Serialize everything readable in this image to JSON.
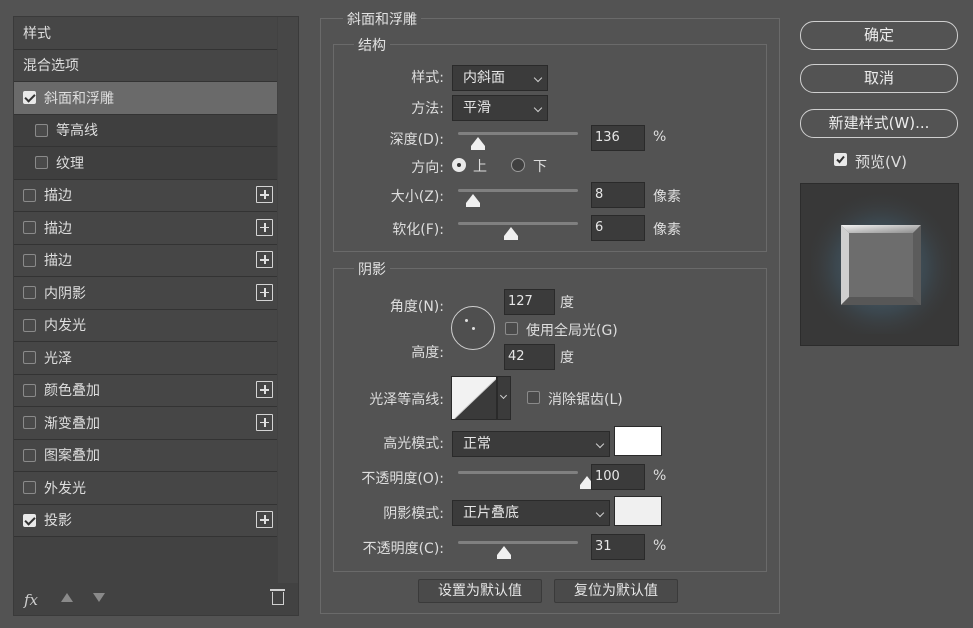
{
  "styles_panel": {
    "header": "样式",
    "blend_options": "混合选项",
    "items": [
      {
        "label": "斜面和浮雕",
        "checked": true,
        "selected": true,
        "plus": false
      },
      {
        "label": "等高线",
        "checked": false,
        "sub": true,
        "plus": false
      },
      {
        "label": "纹理",
        "checked": false,
        "sub": true,
        "plus": false
      },
      {
        "label": "描边",
        "checked": false,
        "plus": true
      },
      {
        "label": "描边",
        "checked": false,
        "plus": true
      },
      {
        "label": "描边",
        "checked": false,
        "plus": true
      },
      {
        "label": "内阴影",
        "checked": false,
        "plus": true
      },
      {
        "label": "内发光",
        "checked": false,
        "plus": false
      },
      {
        "label": "光泽",
        "checked": false,
        "plus": false
      },
      {
        "label": "颜色叠加",
        "checked": false,
        "plus": true
      },
      {
        "label": "渐变叠加",
        "checked": false,
        "plus": true
      },
      {
        "label": "图案叠加",
        "checked": false,
        "plus": false
      },
      {
        "label": "外发光",
        "checked": false,
        "plus": false
      },
      {
        "label": "投影",
        "checked": true,
        "plus": true
      }
    ],
    "footer_fx": "fx"
  },
  "bevel": {
    "title": "斜面和浮雕",
    "structure": {
      "title": "结构",
      "style_label": "样式:",
      "style_value": "内斜面",
      "technique_label": "方法:",
      "technique_value": "平滑",
      "depth_label": "深度(D):",
      "depth_value": "136",
      "depth_unit": "%",
      "depth_level": 0.09,
      "direction_label": "方向:",
      "direction_up": "上",
      "direction_down": "下",
      "size_label": "大小(Z):",
      "size_value": "8",
      "size_unit": "像素",
      "size_level": 0.05,
      "soften_label": "软化(F):",
      "soften_value": "6",
      "soften_unit": "像素",
      "soften_level": 0.37
    },
    "shading": {
      "title": "阴影",
      "angle_label": "角度(N):",
      "angle_value": "127",
      "angle_unit": "度",
      "global_light_label": "使用全局光(G)",
      "altitude_label": "高度:",
      "altitude_value": "42",
      "altitude_unit": "度",
      "gloss_label": "光泽等高线:",
      "antialias_label": "消除锯齿(L)",
      "highlight_mode_label": "高光模式:",
      "highlight_mode_value": "正常",
      "highlight_color": "#ffffff",
      "highlight_opacity_label": "不透明度(O):",
      "highlight_opacity_value": "100",
      "highlight_opacity_unit": "%",
      "highlight_opacity_level": 1.0,
      "shadow_mode_label": "阴影模式:",
      "shadow_mode_value": "正片叠底",
      "shadow_color": "#f0f0f0",
      "shadow_opacity_label": "不透明度(C):",
      "shadow_opacity_value": "31",
      "shadow_opacity_unit": "%",
      "shadow_opacity_level": 0.31
    },
    "make_default": "设置为默认值",
    "reset_default": "复位为默认值"
  },
  "actions": {
    "ok": "确定",
    "cancel": "取消",
    "new_style": "新建样式(W)...",
    "preview_label": "预览(V)"
  }
}
